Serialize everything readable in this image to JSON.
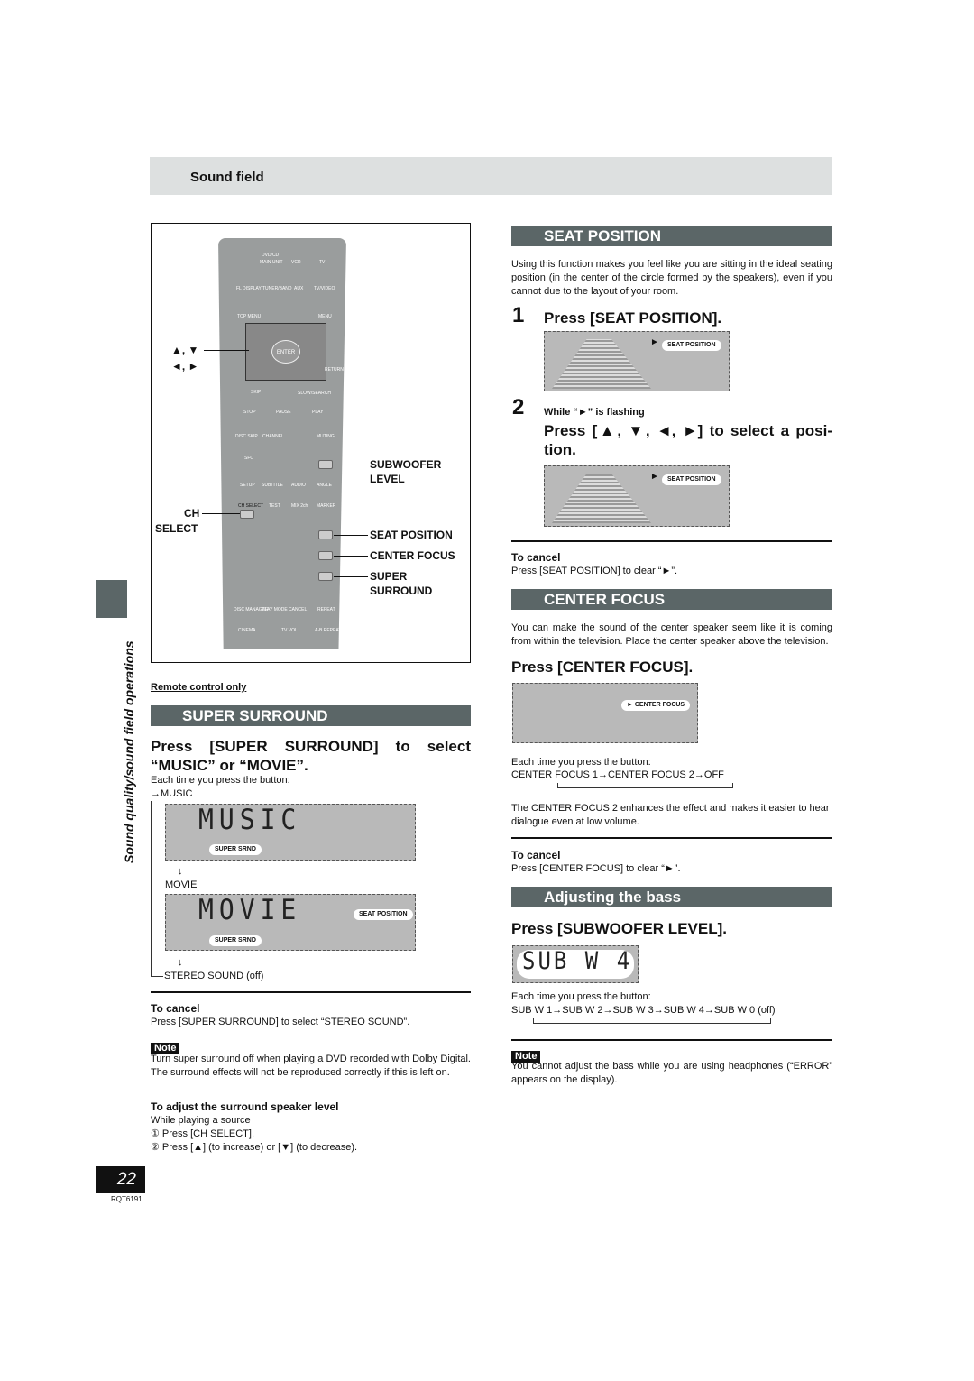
{
  "header": {
    "title": "Sound field"
  },
  "side_tab": {
    "label": "Sound quality/sound field operations"
  },
  "remote": {
    "buttons": [
      "DVD/CD",
      "MAIN UNIT",
      "VCR",
      "TV",
      "FL DISPLAY",
      "TUNER/BAND",
      "AUX",
      "TV/VIDEO",
      "TOP MENU",
      "MENU",
      "ENTER",
      "DISPLAY",
      "RETURN",
      "SKIP",
      "SLOW/SEARCH",
      "STOP",
      "PAUSE",
      "PLAY",
      "DISC SKIP",
      "CHANNEL",
      "VOLUME",
      "MUTING",
      "SFC",
      "SUBWOOFER LEVEL",
      "SETUP",
      "SUBTITLE",
      "AUDIO",
      "ANGLE",
      "CH SELECT",
      "TEST",
      "MIX 2ch",
      "MARKER",
      "SEAT POSITION",
      "CENTER FOCUS",
      "SUPER SURROUND",
      "DISC MANAGER",
      "PLAY MODE",
      "CANCEL",
      "REPEAT",
      "CINEMA",
      "TV VOL",
      "A-B REPEAT"
    ],
    "callouts": {
      "arrows_ud": "▲, ▼",
      "arrows_lr": "◄, ►",
      "subwoofer": "SUBWOOFER",
      "subwoofer2": "LEVEL",
      "ch": "CH",
      "ch2": "SELECT",
      "seat": "SEAT POSITION",
      "center": "CENTER FOCUS",
      "super": "SUPER",
      "super2": "SURROUND"
    }
  },
  "left": {
    "remote_only": "Remote control only",
    "super_surround": {
      "title": "SUPER SURROUND",
      "heading": "Press [SUPER SURROUND] to select “MUSIC” or “MOVIE”.",
      "each_time": "Each time you press the button:",
      "music": "→MUSIC",
      "music_lcd": "MUSIC",
      "movie": "MOVIE",
      "movie_lcd": "MOVIE",
      "stereo": "STEREO SOUND (off)",
      "down_arrow": "↓",
      "pill_srnd": "SUPER SRND",
      "pill_seat": "SEAT POSITION"
    },
    "cancel": {
      "title": "To cancel",
      "text": "Press [SUPER SURROUND] to select “STEREO SOUND”."
    },
    "note": {
      "label": "Note",
      "text": "Turn super surround off when playing a DVD recorded with Dolby Digital. The surround effects will not be reproduced correctly if this is left on."
    },
    "adjust": {
      "title": "To adjust the surround speaker level",
      "line1": "While playing a source",
      "step1": "① Press [CH SELECT].",
      "step2": "② Press [▲] (to increase) or [▼] (to decrease)."
    }
  },
  "footer": {
    "page": "22",
    "code": "RQT6191"
  },
  "right": {
    "seat": {
      "title": "SEAT POSITION",
      "intro": "Using this function makes you feel like you are sitting in the ideal seating position (in the center of the circle formed by the speakers), even if you cannot due to the layout of your room.",
      "step1_num": "1",
      "step1": "Press [SEAT POSITION].",
      "step2_num": "2",
      "step2_sub": "While “►” is flashing",
      "step2": "Press [▲, ▼, ◄, ►] to select a posi-tion.",
      "pill": "SEAT POSITION",
      "cancel_title": "To cancel",
      "cancel_text": "Press [SEAT POSITION] to clear “►”."
    },
    "center": {
      "title": "CENTER FOCUS",
      "intro": "You can make the sound of the center speaker seem like it is coming from within the television. Place the center speaker above the television.",
      "heading": "Press [CENTER FOCUS].",
      "pill": "► CENTER FOCUS",
      "each_time": "Each time you press the button:",
      "sequence": "CENTER FOCUS 1→CENTER FOCUS 2→OFF",
      "desc": "The CENTER FOCUS 2 enhances the effect and makes it easier to hear dialogue even at low volume.",
      "cancel_title": "To cancel",
      "cancel_text": "Press [CENTER FOCUS] to clear “►”."
    },
    "bass": {
      "title": "Adjusting the bass",
      "heading": "Press [SUBWOOFER LEVEL].",
      "lcd": "SUB W 4",
      "each_time": "Each time you press the button:",
      "sequence": "SUB W 1→SUB W 2→SUB W 3→SUB W 4→SUB W 0 (off)",
      "note_label": "Note",
      "note": "You cannot adjust the bass while you are using headphones (“ERROR” appears on the display)."
    }
  },
  "colors": {
    "section_bar": "#5b6667",
    "header_band": "#dde0e0",
    "display": "#b9b9b9"
  }
}
